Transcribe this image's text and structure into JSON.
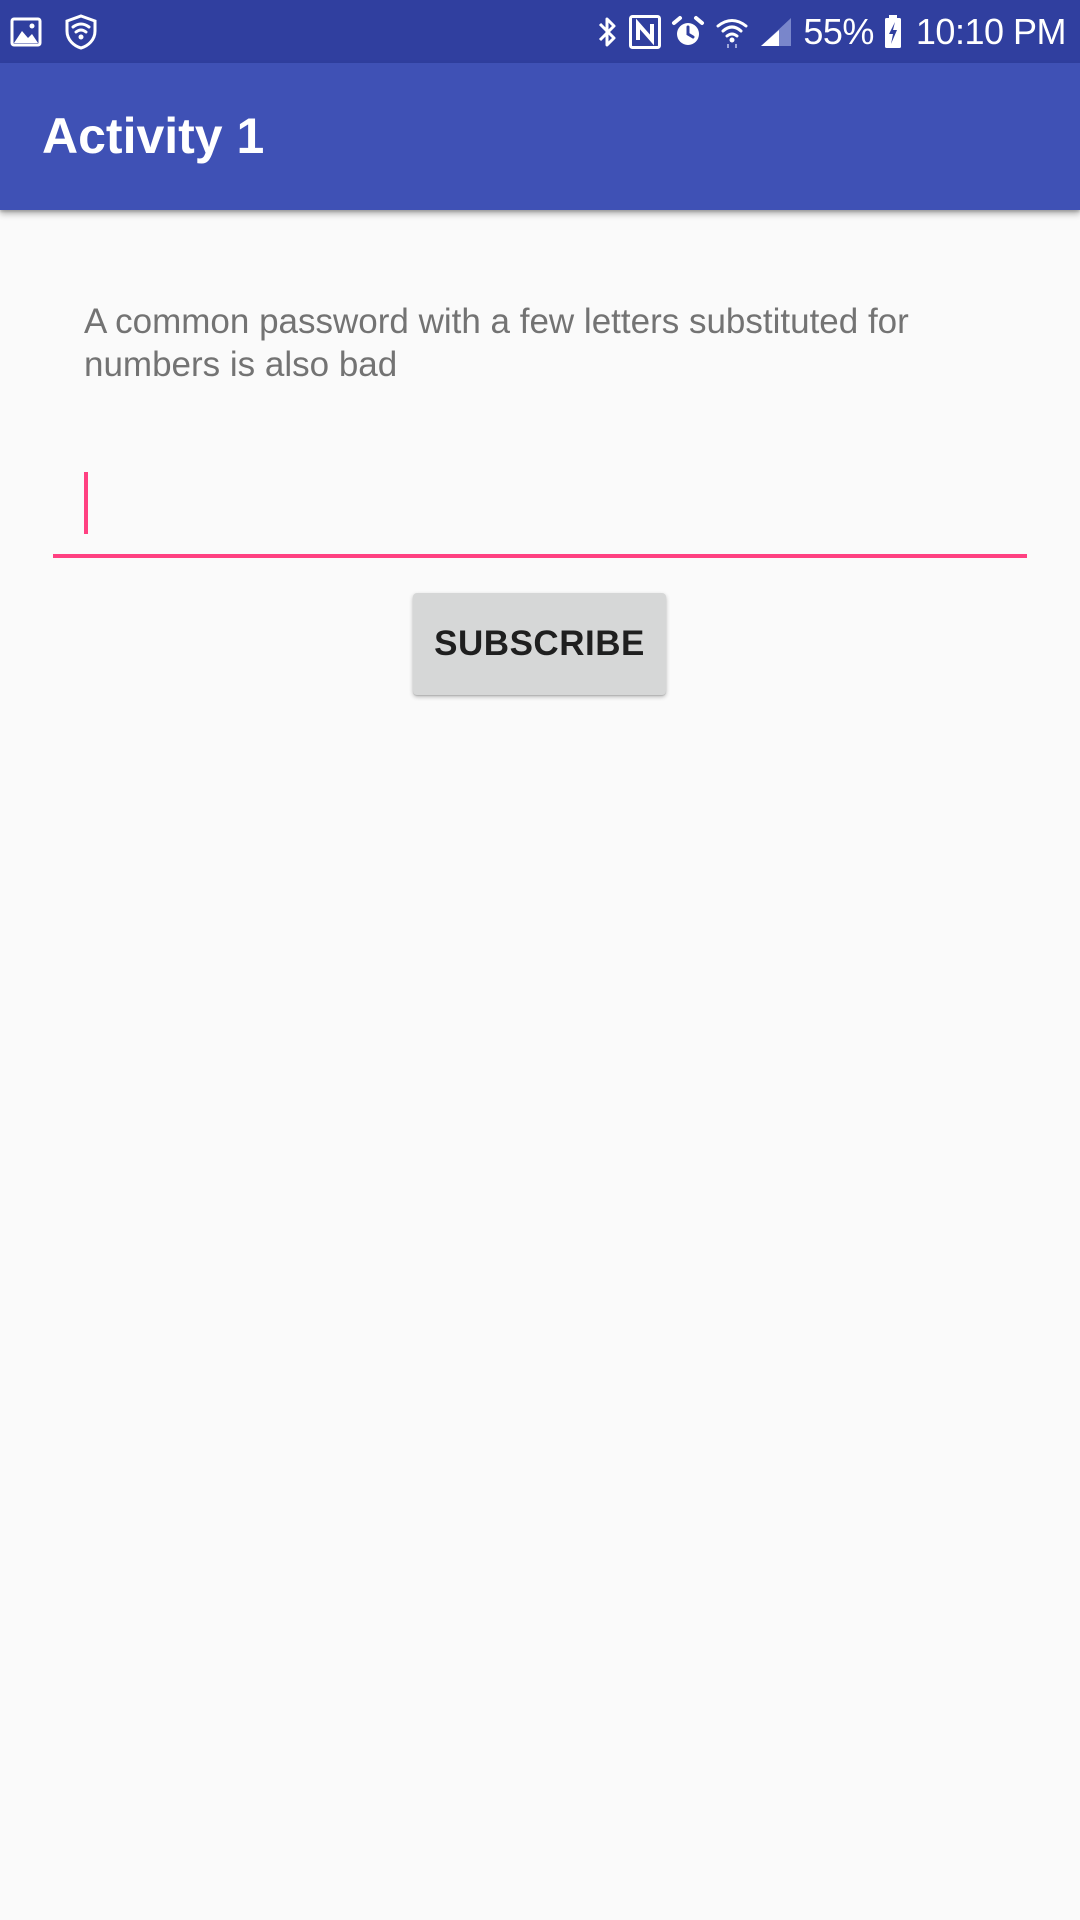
{
  "status_bar": {
    "battery_percent_text": "55%",
    "time": "10:10 PM",
    "left_icons": [
      "gallery-icon",
      "shield-icon"
    ],
    "right_icons": [
      "bluetooth-icon",
      "nfc-icon",
      "alarm-icon",
      "wifi-icon",
      "signal-icon",
      "battery-charging-icon"
    ]
  },
  "app_bar": {
    "title": "Activity 1"
  },
  "main": {
    "prompt_text": "A common password with a few letters substituted for numbers is also bad",
    "password_input": {
      "value": "",
      "placeholder": ""
    },
    "subscribe_label": "SUBSCRIBE"
  },
  "colors": {
    "status_bar": "#303f9f",
    "app_bar": "#3f51b5",
    "accent": "#ff4081",
    "background": "#fafafa",
    "button_bg": "#d6d7d7"
  }
}
